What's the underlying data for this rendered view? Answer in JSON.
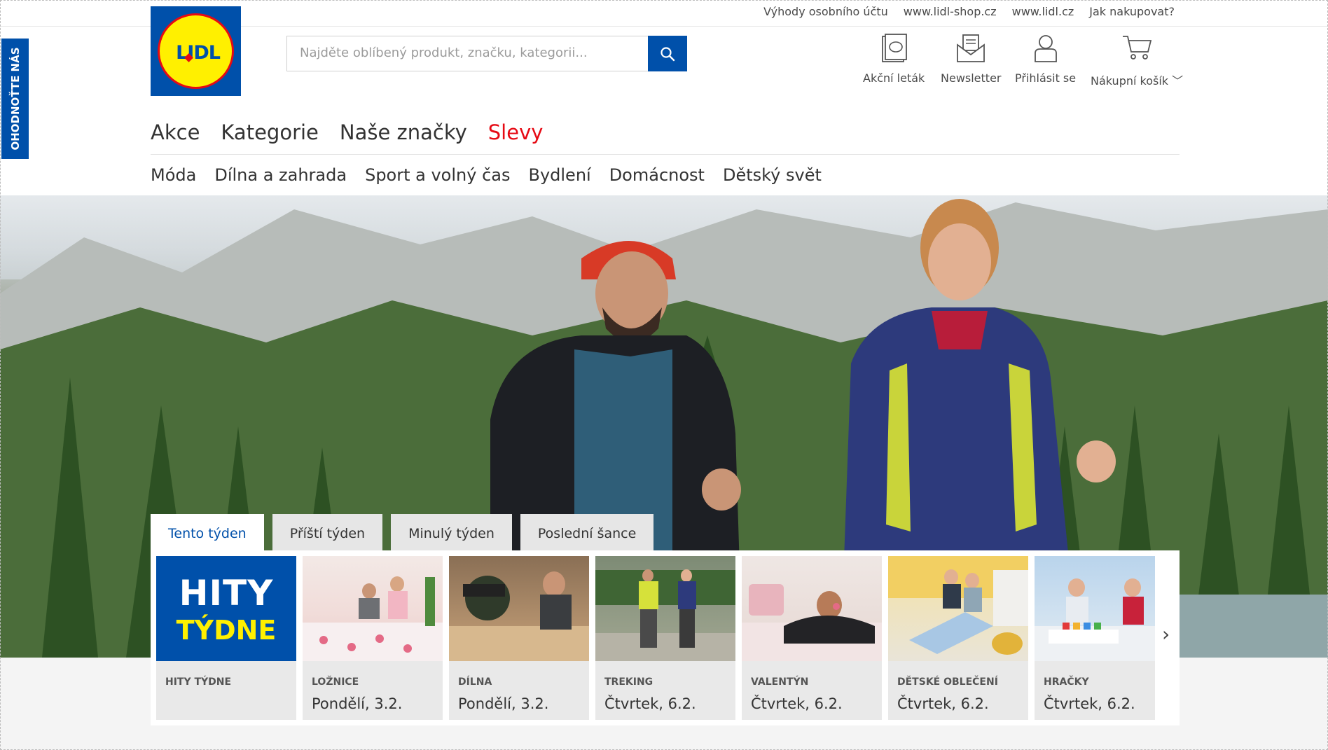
{
  "header": {
    "top_links": [
      "Výhody osobního účtu",
      "www.lidl-shop.cz",
      "www.lidl.cz",
      "Jak nakupovat?"
    ],
    "logo_text": "LIDL",
    "search_placeholder": "Najděte oblíbený produkt, značku, kategorii...",
    "actions": {
      "leaflet": "Akční leták",
      "newsletter": "Newsletter",
      "login": "Přihlásit se",
      "cart": "Nákupní košík"
    }
  },
  "feedback_tab": "OHODNOŤTE NÁS",
  "main_nav": [
    "Akce",
    "Kategorie",
    "Naše značky",
    "Slevy"
  ],
  "sub_nav": [
    "Móda",
    "Dílna a zahrada",
    "Sport a volný čas",
    "Bydlení",
    "Domácnost",
    "Dětský svět"
  ],
  "offers": {
    "tabs": [
      "Tento týden",
      "Příští týden",
      "Minulý týden",
      "Poslední šance"
    ],
    "active_tab": "Tento týden",
    "hity": {
      "line1": "HITY",
      "line2": "TÝDNE"
    },
    "cards": [
      {
        "category": "HITY TÝDNE",
        "date": ""
      },
      {
        "category": "LOŽNICE",
        "date": "Pondělí, 3.2."
      },
      {
        "category": "DÍLNA",
        "date": "Pondělí, 3.2."
      },
      {
        "category": "TREKING",
        "date": "Čtvrtek, 6.2."
      },
      {
        "category": "VALENTÝN",
        "date": "Čtvrtek, 6.2."
      },
      {
        "category": "DĚTSKÉ OBLEČENÍ",
        "date": "Čtvrtek, 6.2."
      },
      {
        "category": "HRAČKY",
        "date": "Čtvrtek, 6.2."
      }
    ],
    "next_arrow": "›"
  },
  "colors": {
    "brand_blue": "#0050aa",
    "brand_yellow": "#fff000",
    "brand_red": "#e60a14"
  }
}
